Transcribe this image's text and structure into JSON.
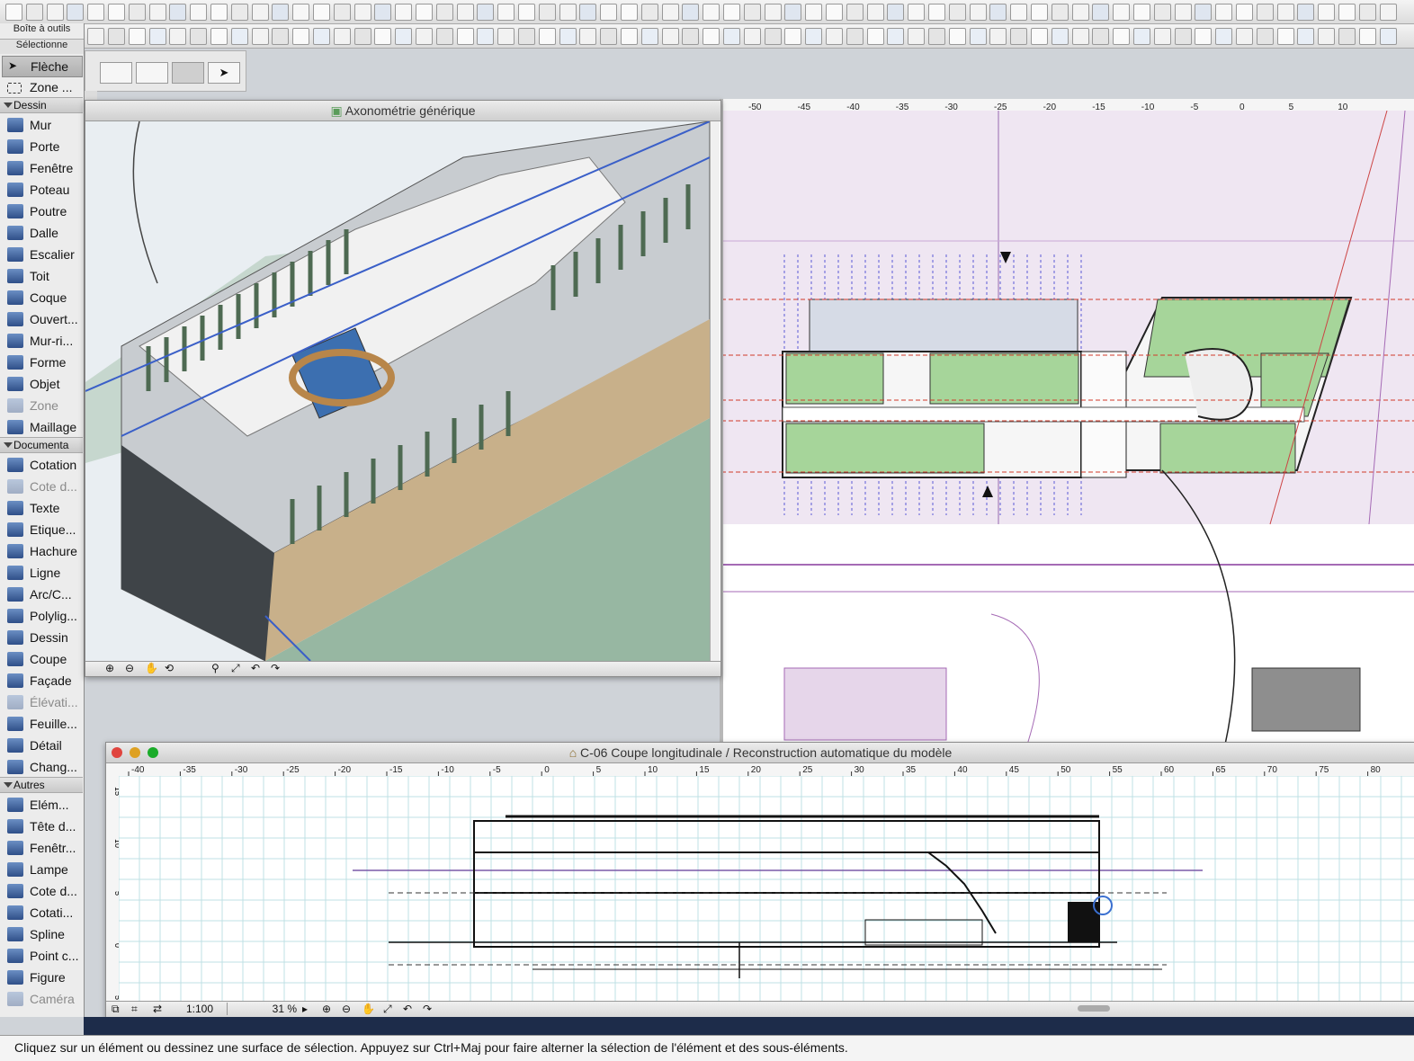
{
  "toolbox": {
    "title": "Boîte à outils",
    "select_header": "Sélectionne",
    "select_tools": [
      {
        "label": "Flèche",
        "icon": "arrow-pointer-icon"
      },
      {
        "label": "Zone ...",
        "icon": "marquee-icon"
      }
    ],
    "sections": [
      {
        "label": "Dessin",
        "tools": [
          {
            "label": "Mur",
            "icon": "wall-icon"
          },
          {
            "label": "Porte",
            "icon": "door-icon"
          },
          {
            "label": "Fenêtre",
            "icon": "window-icon"
          },
          {
            "label": "Poteau",
            "icon": "column-icon"
          },
          {
            "label": "Poutre",
            "icon": "beam-icon"
          },
          {
            "label": "Dalle",
            "icon": "slab-icon"
          },
          {
            "label": "Escalier",
            "icon": "stair-icon"
          },
          {
            "label": "Toit",
            "icon": "roof-icon"
          },
          {
            "label": "Coque",
            "icon": "shell-icon"
          },
          {
            "label": "Ouvert...",
            "icon": "opening-icon"
          },
          {
            "label": "Mur-ri...",
            "icon": "curtain-wall-icon"
          },
          {
            "label": "Forme",
            "icon": "morph-icon"
          },
          {
            "label": "Objet",
            "icon": "object-icon"
          },
          {
            "label": "Zone",
            "icon": "zone-icon",
            "dim": true
          },
          {
            "label": "Maillage",
            "icon": "mesh-icon"
          }
        ]
      },
      {
        "label": "Documenta",
        "tools": [
          {
            "label": "Cotation",
            "icon": "dimension-icon"
          },
          {
            "label": "Cote d...",
            "icon": "level-dimension-icon",
            "dim": true
          },
          {
            "label": "Texte",
            "icon": "text-icon"
          },
          {
            "label": "Etique...",
            "icon": "label-icon"
          },
          {
            "label": "Hachure",
            "icon": "fill-icon"
          },
          {
            "label": "Ligne",
            "icon": "line-icon"
          },
          {
            "label": "Arc/C...",
            "icon": "arc-icon"
          },
          {
            "label": "Polylig...",
            "icon": "polyline-icon"
          },
          {
            "label": "Dessin",
            "icon": "drawing-icon"
          },
          {
            "label": "Coupe",
            "icon": "section-icon"
          },
          {
            "label": "Façade",
            "icon": "elevation-icon"
          },
          {
            "label": "Élévati...",
            "icon": "interior-elevation-icon",
            "dim": true
          },
          {
            "label": "Feuille...",
            "icon": "worksheet-icon"
          },
          {
            "label": "Détail",
            "icon": "detail-icon"
          },
          {
            "label": "Chang...",
            "icon": "change-icon"
          }
        ]
      },
      {
        "label": "Autres",
        "tools": [
          {
            "label": "Elém...",
            "icon": "grid-element-icon"
          },
          {
            "label": "Tête d...",
            "icon": "wall-end-icon"
          },
          {
            "label": "Fenêtr...",
            "icon": "corner-window-icon"
          },
          {
            "label": "Lampe",
            "icon": "lamp-icon"
          },
          {
            "label": "Cote d...",
            "icon": "radial-dimension-icon"
          },
          {
            "label": "Cotati...",
            "icon": "angle-dimension-icon"
          },
          {
            "label": "Spline",
            "icon": "spline-icon"
          },
          {
            "label": "Point c...",
            "icon": "hotspot-icon"
          },
          {
            "label": "Figure",
            "icon": "figure-icon"
          },
          {
            "label": "Caméra",
            "icon": "camera-icon",
            "dim": true
          }
        ]
      }
    ]
  },
  "axo_window": {
    "title": "Axonométrie générique"
  },
  "plan_window": {
    "ruler_ticks": [
      "-50",
      "-45",
      "-40",
      "-35",
      "-30",
      "-25",
      "-20",
      "-15",
      "-10",
      "-5",
      "0",
      "5",
      "10"
    ]
  },
  "section_window": {
    "title": "C-06 Coupe longitudinale / Reconstruction automatique du modèle",
    "ruler_ticks": [
      "-40",
      "-35",
      "-30",
      "-25",
      "-20",
      "-15",
      "-10",
      "-5",
      "0",
      "5",
      "10",
      "15",
      "20",
      "25",
      "30",
      "35",
      "40",
      "45",
      "50",
      "55",
      "60",
      "65",
      "70",
      "75",
      "80"
    ],
    "vruler_ticks": [
      "15",
      "10",
      "5",
      "0",
      "5"
    ],
    "scale": "1:100",
    "zoom": "31 %"
  },
  "status_bar": {
    "message": "Cliquez sur un élément ou dessinez une surface de sélection. Appuyez sur Ctrl+Maj pour faire alterner la sélection de l'élément et des sous-éléments."
  },
  "colors": {
    "plan_background": "#efe6f2",
    "room_green": "#a6d59a",
    "section_grid": "#bfe1e4",
    "axo_floor": "#97b7a2",
    "window_close": "#e0443e",
    "window_min": "#dea123",
    "window_zoom": "#1aab29"
  }
}
